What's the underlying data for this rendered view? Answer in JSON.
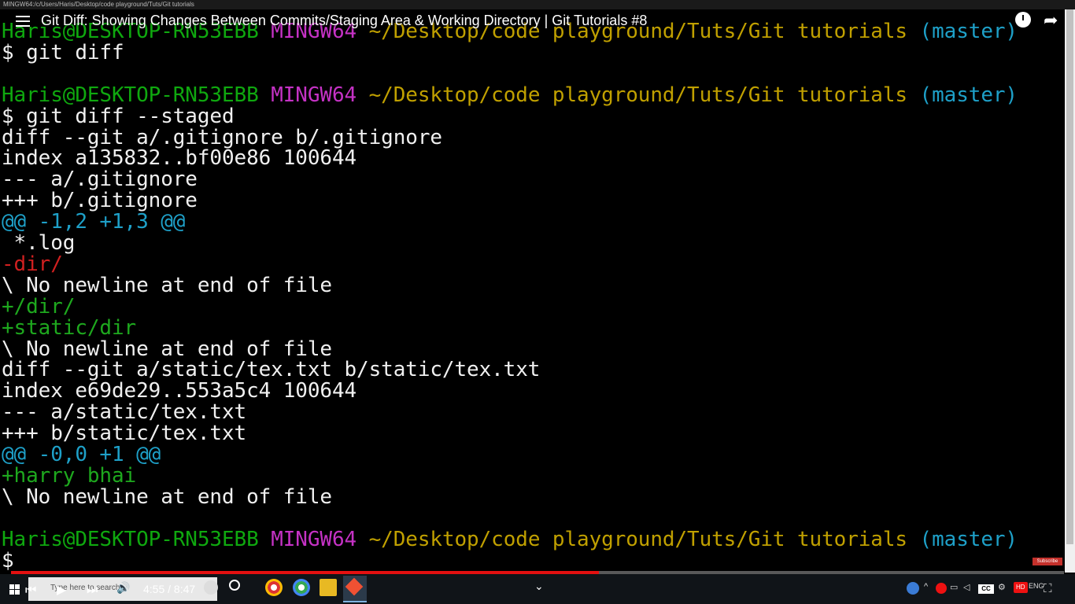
{
  "window": {
    "tiny_title": "MINGW64:/c/Users/Haris/Desktop/code playground/Tuts/Git tutorials"
  },
  "youtube": {
    "title": "Git Diff: Showing Changes Between Commits/Staging Area & Working Directory | Git Tutorials #8",
    "time_current": "4:55",
    "time_total": "8:47",
    "time_display": "4:55 / 8:47",
    "progress_fraction": 0.558,
    "subscribe_label": "Subscribe",
    "play_glyph": "▶",
    "skip_glyph": "⏭",
    "prev_glyph": "⏮",
    "volume_glyph": "🔊",
    "share_glyph": "➦",
    "hd_label": "HD",
    "cc_label": "CC"
  },
  "prompt": {
    "user": "Haris@DESKTOP-RN53EBB",
    "shell": "MINGW64",
    "path": "~/Desktop/code playground/Tuts/Git tutorials",
    "branch": "(master)"
  },
  "terminal_lines": [
    {
      "kind": "prompt"
    },
    {
      "kind": "text",
      "text": "$ git diff",
      "color": "white"
    },
    {
      "kind": "blank"
    },
    {
      "kind": "prompt"
    },
    {
      "kind": "text",
      "text": "$ git diff --staged",
      "color": "white"
    },
    {
      "kind": "text",
      "text": "diff --git a/.gitignore b/.gitignore",
      "color": "white"
    },
    {
      "kind": "text",
      "text": "index a135832..bf00e86 100644",
      "color": "white"
    },
    {
      "kind": "text",
      "text": "--- a/.gitignore",
      "color": "white"
    },
    {
      "kind": "text",
      "text": "+++ b/.gitignore",
      "color": "white"
    },
    {
      "kind": "text",
      "text": "@@ -1,2 +1,3 @@",
      "color": "hunk"
    },
    {
      "kind": "text",
      "text": " *.log",
      "color": "white"
    },
    {
      "kind": "text",
      "text": "-dir/",
      "color": "del"
    },
    {
      "kind": "text",
      "text": "\\ No newline at end of file",
      "color": "white"
    },
    {
      "kind": "text",
      "text": "+/dir/",
      "color": "add"
    },
    {
      "kind": "text",
      "text": "+static/dir",
      "color": "add"
    },
    {
      "kind": "text",
      "text": "\\ No newline at end of file",
      "color": "white"
    },
    {
      "kind": "text",
      "text": "diff --git a/static/tex.txt b/static/tex.txt",
      "color": "white"
    },
    {
      "kind": "text",
      "text": "index e69de29..553a5c4 100644",
      "color": "white"
    },
    {
      "kind": "text",
      "text": "--- a/static/tex.txt",
      "color": "white"
    },
    {
      "kind": "text",
      "text": "+++ b/static/tex.txt",
      "color": "white"
    },
    {
      "kind": "text",
      "text": "@@ -0,0 +1 @@",
      "color": "hunk"
    },
    {
      "kind": "text",
      "text": "+harry bhai",
      "color": "add"
    },
    {
      "kind": "text",
      "text": "\\ No newline at end of file",
      "color": "white"
    },
    {
      "kind": "blank"
    },
    {
      "kind": "prompt"
    },
    {
      "kind": "text",
      "text": "$",
      "color": "white"
    }
  ],
  "taskbar": {
    "search_placeholder": "Type here to search",
    "language": "ENG",
    "chevron_glyph": "⌄"
  },
  "colors": {
    "user": "#0fa80f",
    "shell": "#c532c5",
    "path": "#c0a000",
    "branch": "#1ea0c8",
    "del": "#d02020",
    "add": "#1ea81e",
    "progress": "#e41010"
  }
}
